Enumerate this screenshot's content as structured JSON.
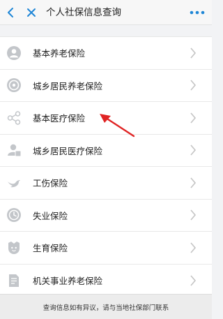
{
  "header": {
    "title": "个人社保信息查询"
  },
  "icons": {
    "back": "chevron-left-icon",
    "close": "close-icon",
    "more": "more-dots-icon",
    "chevron": "chevron-right-icon",
    "annotation": "red-arrow"
  },
  "colors": {
    "accent": "#1e86d6",
    "icon_gray": "#b9bcc0",
    "annotation_red": "#e02424"
  },
  "items": [
    {
      "label": "基本养老保险",
      "icon": "person-icon"
    },
    {
      "label": "城乡居民养老保险",
      "icon": "pension-badge-icon"
    },
    {
      "label": "基本医疗保险",
      "icon": "share-nodes-icon"
    },
    {
      "label": "城乡居民医疗保险",
      "icon": "user-card-icon"
    },
    {
      "label": "工伤保险",
      "icon": "bird-icon"
    },
    {
      "label": "失业保险",
      "icon": "clock-icon"
    },
    {
      "label": "生育保险",
      "icon": "baby-face-icon"
    },
    {
      "label": "机关事业养老保险",
      "icon": "document-icon"
    }
  ],
  "footer": {
    "text": "查询信息如有异议，请与当地社保部门联系"
  }
}
